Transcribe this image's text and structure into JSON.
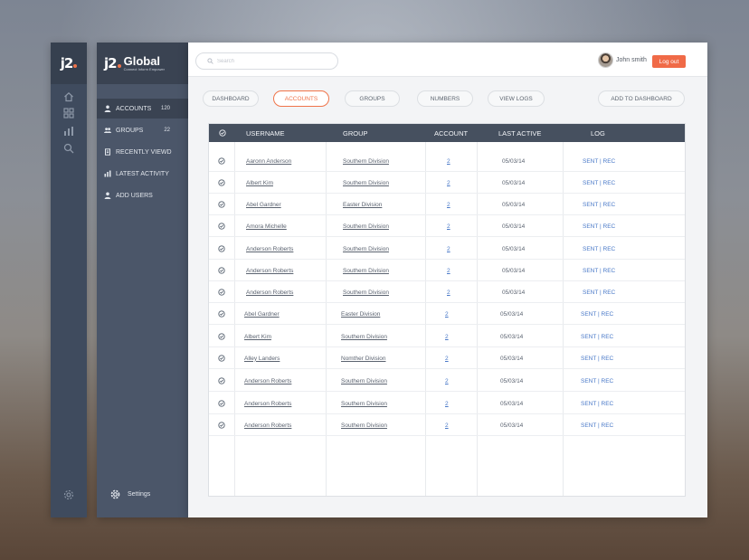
{
  "brand": {
    "mark": "j2",
    "name": "Global",
    "tagline": "Connect Inform Empower"
  },
  "rail": {
    "icons": [
      "home-icon",
      "grid-icon",
      "bar-chart-icon",
      "search-icon",
      "gear-icon"
    ]
  },
  "sidebar": {
    "items": [
      {
        "label": "ACCOUNTS",
        "count": "120",
        "icon": "user-icon"
      },
      {
        "label": "GROUPS",
        "count": "22",
        "icon": "group-icon"
      },
      {
        "label": "RECENTLY VIEWD",
        "count": "",
        "icon": "document-icon"
      },
      {
        "label": "LATEST ACTIVITY",
        "count": "",
        "icon": "chart-icon"
      },
      {
        "label": "ADD USERS",
        "count": "",
        "icon": "user-add-icon"
      }
    ],
    "settings_label": "Settings"
  },
  "header": {
    "search_placeholder": "Search",
    "user_name": "John smith",
    "logout_label": "Log out"
  },
  "tabs": [
    {
      "label": "DASHBOARD",
      "active": false
    },
    {
      "label": "ACCOUNTS",
      "active": true
    },
    {
      "label": "GROUPS",
      "active": false
    },
    {
      "label": "NUMBERS",
      "active": false
    },
    {
      "label": "VIEW LOGS",
      "active": false
    }
  ],
  "add_to_dashboard_label": "ADD TO DASHBOARD",
  "table": {
    "columns": [
      "USERNAME",
      "GROUP",
      "ACCOUNT",
      "LAST ACTIVE",
      "LOG"
    ],
    "rows": [
      {
        "username": "Aaronn Anderson",
        "group": "Southern Division",
        "account": "2",
        "last_active": "05/03/14",
        "log": "SENT | REC"
      },
      {
        "username": "Albert Kim",
        "group": "Southern Division",
        "account": "2",
        "last_active": "05/03/14",
        "log": "SENT | REC"
      },
      {
        "username": "Abel Gardner",
        "group": "Easter Division",
        "account": "2",
        "last_active": "05/03/14",
        "log": "SENT | REC"
      },
      {
        "username": "Amora Michelle",
        "group": "Southern Division",
        "account": "2",
        "last_active": "05/03/14",
        "log": "SENT | REC"
      },
      {
        "username": "Anderson Roberts",
        "group": "Southern Division",
        "account": "2",
        "last_active": "05/03/14",
        "log": "SENT | REC"
      },
      {
        "username": "Anderson Roberts",
        "group": "Southern Division",
        "account": "2",
        "last_active": "05/03/14",
        "log": "SENT | REC"
      },
      {
        "username": "Anderson Roberts",
        "group": "Southern Division",
        "account": "2",
        "last_active": "05/03/14",
        "log": "SENT | REC"
      },
      {
        "username": "Abel Gardner",
        "group": "Easter Division",
        "account": "2",
        "last_active": "05/03/14",
        "log": "SENT | REC"
      },
      {
        "username": "Albert Kim",
        "group": "Southern Division",
        "account": "2",
        "last_active": "05/03/14",
        "log": "SENT | REC"
      },
      {
        "username": "Alley Landers",
        "group": "Nomther Division",
        "account": "2",
        "last_active": "05/03/14",
        "log": "SENT | REC"
      },
      {
        "username": "Anderson Roberts",
        "group": "Southern Division",
        "account": "2",
        "last_active": "05/03/14",
        "log": "SENT | REC"
      },
      {
        "username": "Anderson Roberts",
        "group": "Southern Division",
        "account": "2",
        "last_active": "05/03/14",
        "log": "SENT | REC"
      },
      {
        "username": "Anderson Roberts",
        "group": "Southern Division",
        "account": "2",
        "last_active": "05/03/14",
        "log": "SENT | REC"
      }
    ]
  },
  "colors": {
    "accent": "#f0744a",
    "sidebar": "#4b5669",
    "table_header": "#46505f",
    "link": "#4a79c8"
  }
}
